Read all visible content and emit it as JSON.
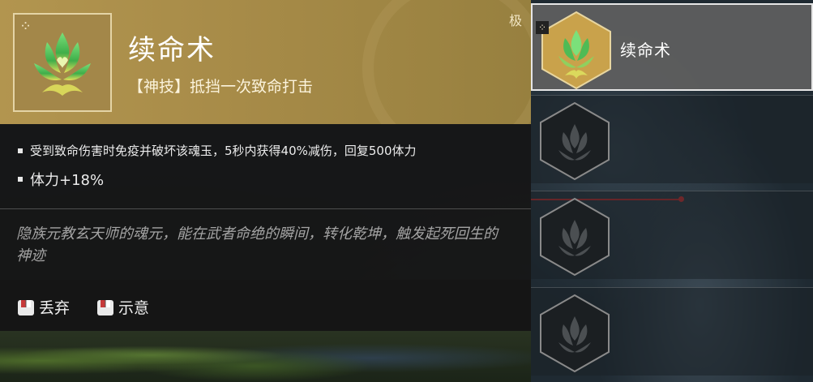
{
  "item": {
    "name": "续命术",
    "rarity": "极",
    "subtitle": "【神技】抵挡一次致命打击",
    "icon": "green-lotus-flame-icon",
    "effects": [
      "受到致命伤害时免疫并破坏该魂玉，5秒内获得40%减伤，回复500体力",
      "体力+18%"
    ],
    "lore": "隐族元教玄天师的魂元，能在武者命绝的瞬间，转化乾坤，触发起死回生的神迹"
  },
  "actions": {
    "drop_label": "丢弃",
    "show_label": "示意"
  },
  "slots": [
    {
      "label": "续命术",
      "state": "equipped"
    },
    {
      "label": "",
      "state": "empty"
    },
    {
      "label": "",
      "state": "empty"
    },
    {
      "label": "",
      "state": "empty"
    }
  ],
  "colors": {
    "header_gold": "#b2954f",
    "panel_dark": "#161616",
    "accent_red": "#c42b2b",
    "hex_gold": "#c9a24b"
  }
}
